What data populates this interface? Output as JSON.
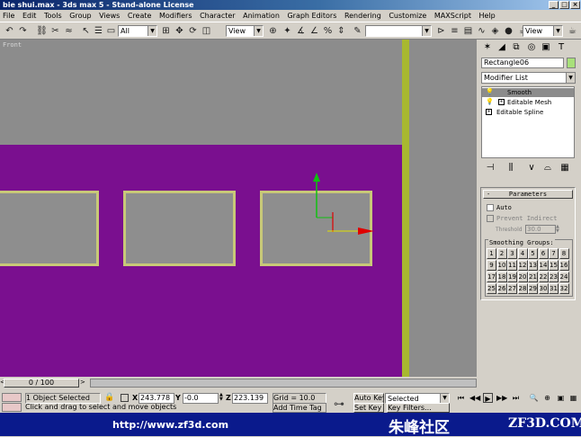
{
  "window": {
    "title": "bie shui.max - 3ds max 5 - Stand-alone License",
    "buttons": [
      "_",
      "□",
      "×"
    ]
  },
  "menu": [
    "File",
    "Edit",
    "Tools",
    "Group",
    "Views",
    "Create",
    "Modifiers",
    "Character",
    "Animation",
    "Graph Editors",
    "Rendering",
    "Customize",
    "MAXScript",
    "Help"
  ],
  "toolbar": {
    "selection_filter": "All",
    "ref_coord": "View",
    "ref_coord2": "View",
    "named_sets": ""
  },
  "viewport": {
    "label": "Front",
    "bg": "#8c8c8c",
    "plane_color": "#7a0f8f",
    "rect_border": "#c8c878"
  },
  "time_slider": {
    "label": "0 / 100"
  },
  "command_panel": {
    "object_name": "Rectangle06",
    "object_color": "#a8e07a",
    "modifier_list": "Modifier List",
    "stack": [
      {
        "label": "Smooth",
        "selected": true
      },
      {
        "label": "Editable Mesh",
        "selected": false
      },
      {
        "label": "Editable Spline",
        "selected": false
      }
    ],
    "rollout": {
      "title": "Parameters",
      "auto": "Auto",
      "prevent_indirect": "Prevent Indirect",
      "threshold_label": "Threshold",
      "threshold_value": "30.0",
      "smoothing_groups_label": "Smoothing Groups:",
      "groups": [
        "1",
        "2",
        "3",
        "4",
        "5",
        "6",
        "7",
        "8",
        "9",
        "10",
        "11",
        "12",
        "13",
        "14",
        "15",
        "16",
        "17",
        "18",
        "19",
        "20",
        "21",
        "22",
        "23",
        "24",
        "25",
        "26",
        "27",
        "28",
        "29",
        "30",
        "31",
        "32"
      ]
    }
  },
  "status": {
    "selected": "1 Object Selected",
    "x_label": "X",
    "x_value": "243.778",
    "y_label": "Y",
    "y_value": "-0.0",
    "z_label": "Z",
    "z_value": "223.139",
    "grid": "Grid = 10.0",
    "prompt": "Click and drag to select and move objects",
    "auto_key": "Auto Key",
    "set_key": "Set Key",
    "key_mode": "Selected",
    "key_filters": "Key Filters...",
    "add_time_tag": "Add Time Tag"
  },
  "footer": {
    "url": "http://www.zf3d.com",
    "cn_text": "朱峰社区",
    "brand": "ZF3D.COM"
  }
}
